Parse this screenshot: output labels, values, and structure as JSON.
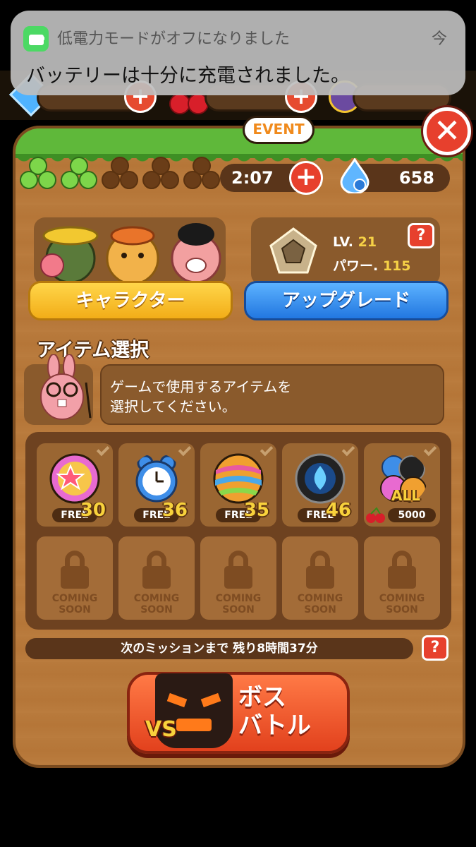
{
  "notification": {
    "title": "低電力モードがオフになりました",
    "time": "今",
    "body": "バッテリーは十分に充電されました。"
  },
  "header": {
    "event_label": "EVENT"
  },
  "hearts": {
    "total": 5,
    "filled": 2
  },
  "timer": {
    "value": "2:07"
  },
  "points": {
    "value": "658"
  },
  "character": {
    "button_label": "キャラクター"
  },
  "upgrade": {
    "level_label": "LV.",
    "level_value": "21",
    "power_label": "パワー.",
    "power_value": "115",
    "button_label": "アップグレード",
    "help": "?"
  },
  "item_select": {
    "title": "アイテム選択",
    "description_line1": "ゲームで使用するアイテムを",
    "description_line2": "選択してください。"
  },
  "items": [
    {
      "name": "star-bomb",
      "badge": "FREE",
      "count": "30",
      "icon_color": "#c85ad8"
    },
    {
      "name": "alarm-clock",
      "badge": "FREE",
      "count": "36",
      "icon_color": "#3e8ee8"
    },
    {
      "name": "rainbow-ball",
      "badge": "FREE",
      "count": "35",
      "icon_color": "#f0a030"
    },
    {
      "name": "blue-flame",
      "badge": "FREE",
      "count": "46",
      "icon_color": "#222222"
    },
    {
      "name": "all-items",
      "badge": "5000",
      "label": "ALL",
      "icon_color": "#3e8ee8"
    }
  ],
  "locked_slots": [
    {
      "line1": "COMING",
      "line2": "SOON"
    },
    {
      "line1": "COMING",
      "line2": "SOON"
    },
    {
      "line1": "COMING",
      "line2": "SOON"
    },
    {
      "line1": "COMING",
      "line2": "SOON"
    },
    {
      "line1": "COMING",
      "line2": "SOON"
    }
  ],
  "mission": {
    "text": "次のミッションまで 残り8時間37分",
    "help": "?"
  },
  "boss": {
    "vs": "VS",
    "line1": "ボス",
    "line2": "バトル"
  },
  "close": "✕"
}
